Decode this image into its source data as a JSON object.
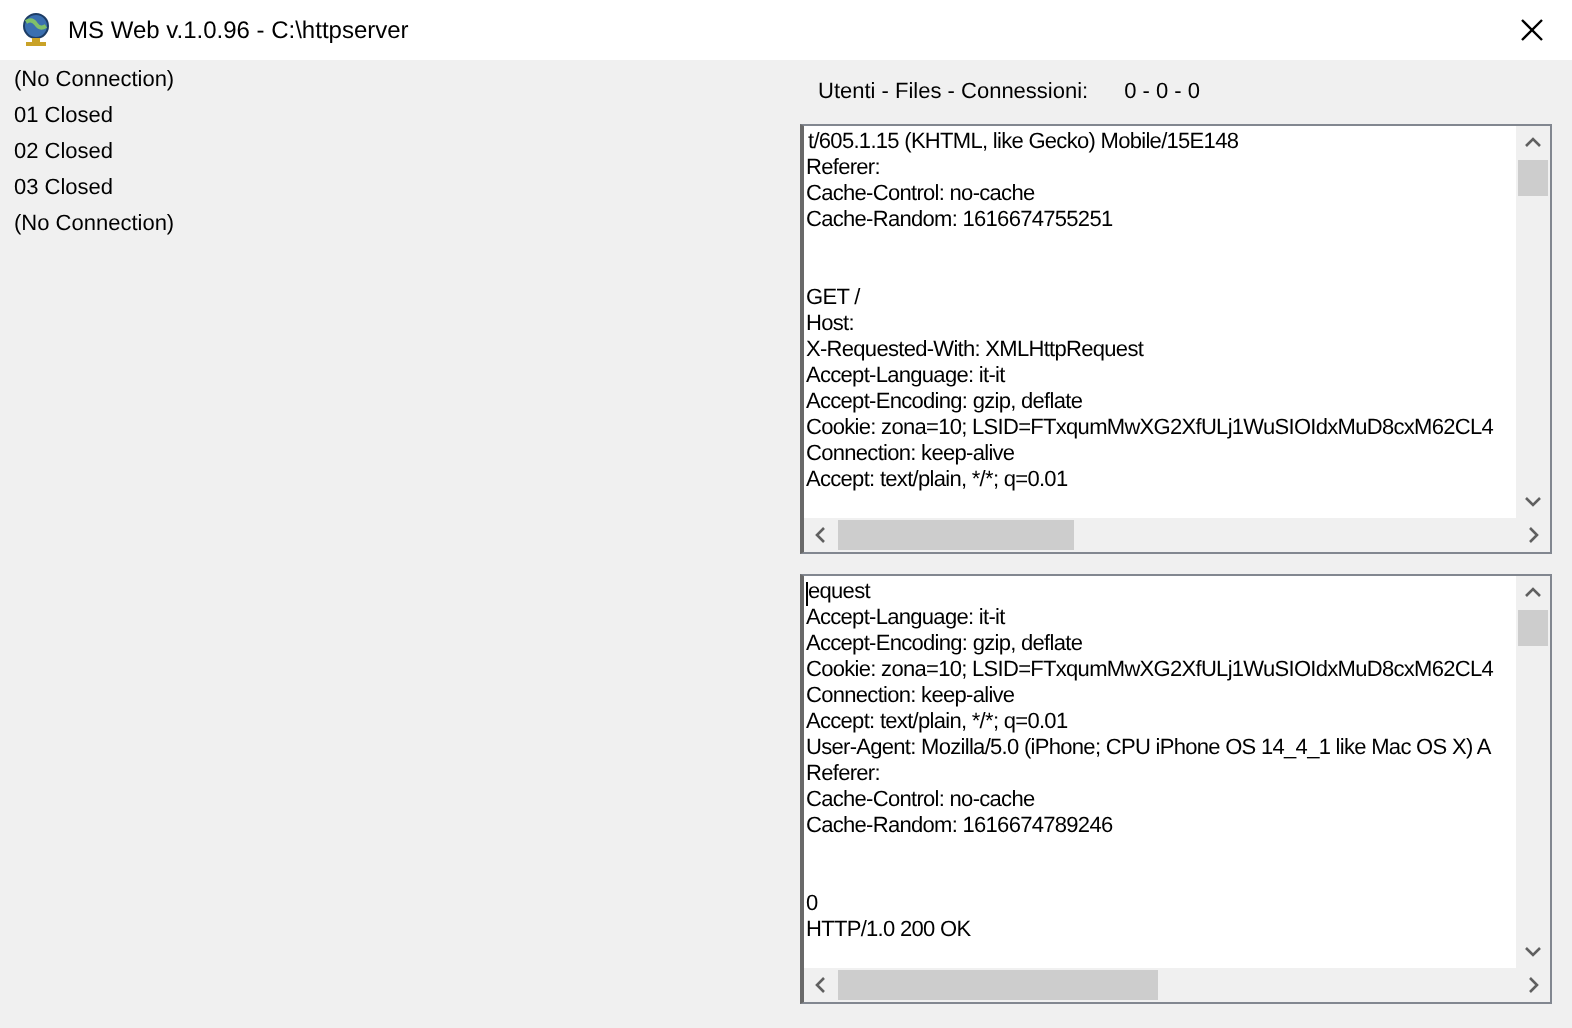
{
  "window": {
    "title": "MS Web v.1.0.96 - C:\\httpserver"
  },
  "connections": [
    "(No Connection)",
    "01 Closed",
    "02 Closed",
    "03 Closed",
    "(No Connection)"
  ],
  "stats": {
    "label": "Utenti - Files - Connessioni:",
    "value": "0 - 0 - 0"
  },
  "logs": [
    {
      "has_caret": false,
      "blocks": [
        [
          "t/605.1.15 (KHTML, like Gecko) Mobile/15E148",
          "Referer:",
          "Cache-Control: no-cache",
          "Cache-Random: 1616674755251"
        ],
        [
          "GET /",
          "Host:",
          "X-Requested-With: XMLHttpRequest",
          "Accept-Language: it-it",
          "Accept-Encoding: gzip, deflate",
          "Cookie: zona=10; LSID=FTxqumMwXG2XfULj1WuSIOIdxMuD8cxM62CL4",
          "Connection: keep-alive",
          "Accept: text/plain, */*; q=0.01"
        ]
      ]
    },
    {
      "has_caret": true,
      "blocks": [
        [
          "equest",
          "Accept-Language: it-it",
          "Accept-Encoding: gzip, deflate",
          "Cookie: zona=10; LSID=FTxqumMwXG2XfULj1WuSIOIdxMuD8cxM62CL4",
          "Connection: keep-alive",
          "Accept: text/plain, */*; q=0.01",
          "User-Agent: Mozilla/5.0 (iPhone; CPU iPhone OS 14_4_1 like Mac OS X) A",
          "Referer:",
          "Cache-Control: no-cache",
          "Cache-Random: 1616674789246"
        ],
        [
          "0",
          "HTTP/1.0 200 OK"
        ]
      ]
    }
  ]
}
